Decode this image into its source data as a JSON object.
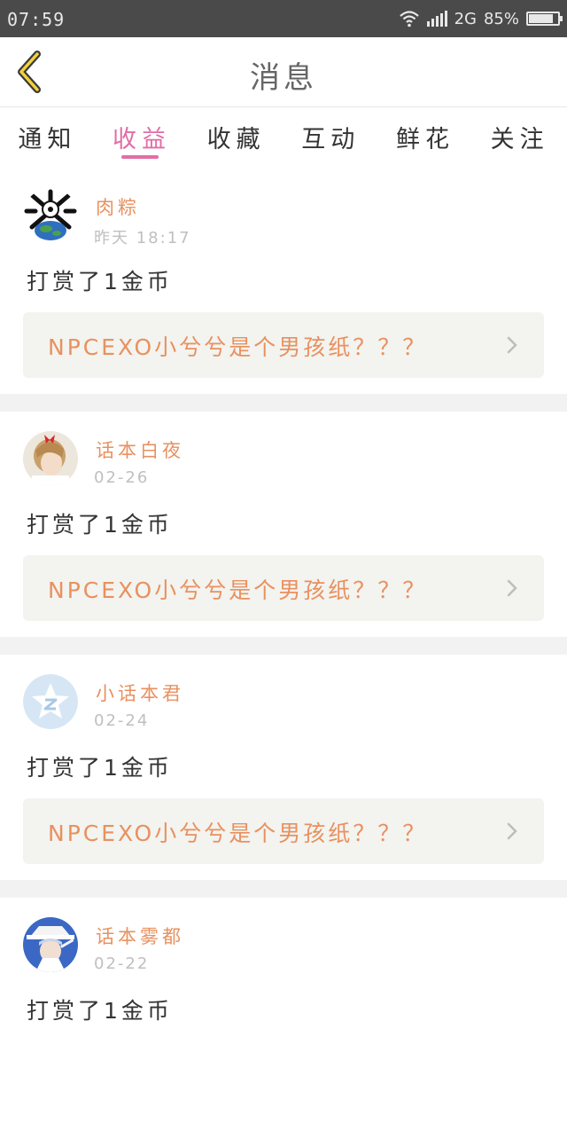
{
  "status_bar": {
    "time": "07:59",
    "network": "2G",
    "battery": "85%",
    "battery_level": 0.85
  },
  "header": {
    "title": "消息",
    "back_icon": "chevron-left-icon"
  },
  "tabs": [
    {
      "label": "通知",
      "active": false
    },
    {
      "label": "收益",
      "active": true
    },
    {
      "label": "收藏",
      "active": false
    },
    {
      "label": "互动",
      "active": false
    },
    {
      "label": "鲜花",
      "active": false
    },
    {
      "label": "关注",
      "active": false
    }
  ],
  "items": [
    {
      "user": "肉粽",
      "time": "昨天 18:17",
      "message": "打赏了1金币",
      "link": "NPCEXO小兮兮是个男孩纸？？？",
      "avatar_icon": "avatar-crossbones-globe"
    },
    {
      "user": "话本白夜",
      "time": "02-26",
      "message": "打赏了1金币",
      "link": "NPCEXO小兮兮是个男孩纸？？？",
      "avatar_icon": "avatar-girl-red-bow"
    },
    {
      "user": "小话本君",
      "time": "02-24",
      "message": "打赏了1金币",
      "link": "NPCEXO小兮兮是个男孩纸？？？",
      "avatar_icon": "avatar-star-z"
    },
    {
      "user": "话本雾都",
      "time": "02-22",
      "message": "打赏了1金币",
      "link": "",
      "avatar_icon": "avatar-anime-hat"
    }
  ],
  "colors": {
    "accent_pink": "#e26da6",
    "accent_orange": "#e8915f",
    "status_bar": "#4a4a4a"
  }
}
